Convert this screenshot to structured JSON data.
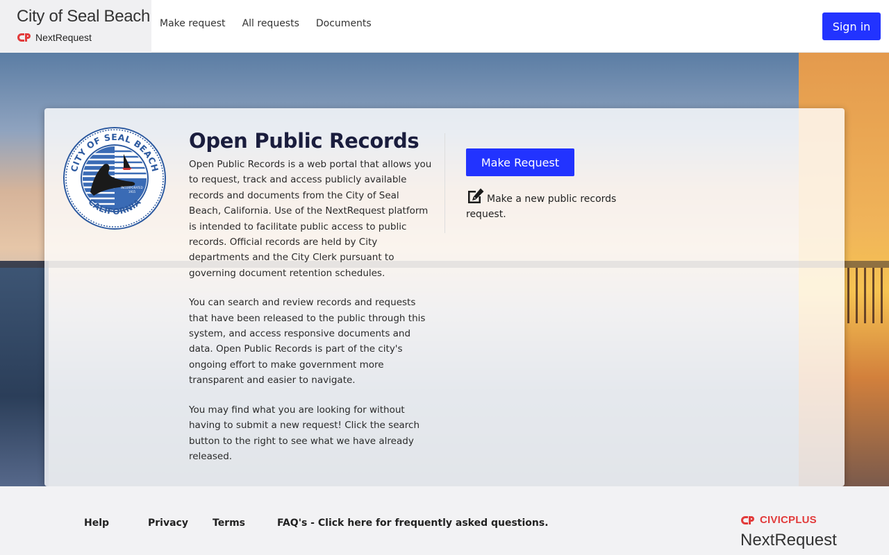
{
  "header": {
    "city_title": "City of Seal Beach",
    "product_name": "NextRequest",
    "logo_icon": "cp-logo-icon",
    "nav": [
      {
        "label": "Make request"
      },
      {
        "label": "All requests"
      },
      {
        "label": "Documents"
      }
    ],
    "signin_label": "Sign in"
  },
  "colors": {
    "accent": "#2233ff",
    "brand_red": "#e23b3b",
    "heading": "#1a1d3d"
  },
  "hero": {
    "seal": {
      "top_text": "CITY OF SEAL BEACH",
      "bottom_text": "CALIFORNIA",
      "incorporated": "INCORPORATED",
      "year": "1915"
    },
    "title": "Open Public Records",
    "paragraphs": [
      "Open Public Records is a web portal that allows you to request, track and access publicly available records and documents from the City of Seal Beach, California. Use of the NextRequest platform is intended to facilitate public access to public records. Official records are held by City departments and the City Clerk pursuant to governing document retention schedules.",
      "You can search and review records and requests that have been released to the public through this system, and access responsive documents and data. Open Public Records is part of the city's ongoing effort to make government more transparent and easier to navigate.",
      "You may find what you are looking for without having to submit a new request! Click the search button to the right to see what we have already released."
    ],
    "make_request_label": "Make Request",
    "make_request_desc": "Make a new public records request.",
    "make_request_icon": "edit-icon"
  },
  "footer": {
    "links": [
      {
        "label": "Help"
      },
      {
        "label": "Privacy"
      },
      {
        "label": "Terms"
      },
      {
        "label": "FAQ's - Click here for frequently asked questions."
      }
    ],
    "civic_label": "CIVICPLUS",
    "nextrequest_label": "NextRequest"
  }
}
